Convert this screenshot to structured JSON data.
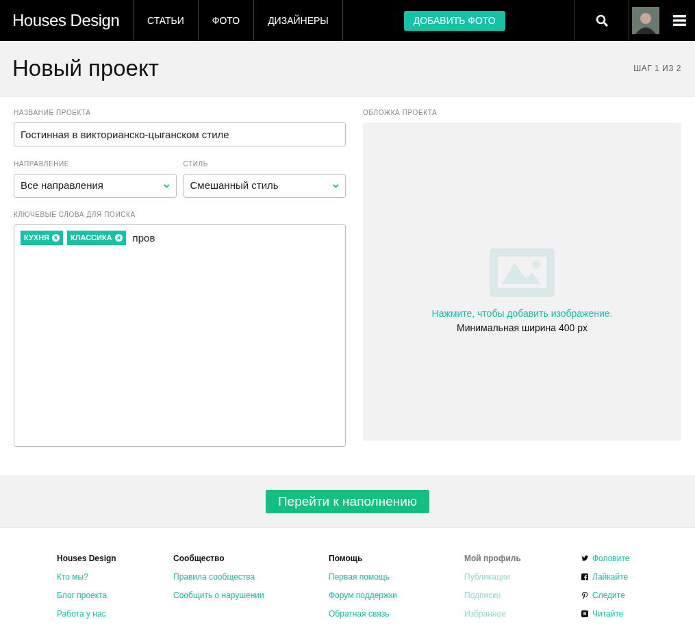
{
  "header": {
    "logo": "Houses **Design**",
    "nav": [
      {
        "label": "СТАТЬИ"
      },
      {
        "label": "ФОТО"
      },
      {
        "label": "ДИЗАЙНЕРЫ"
      }
    ],
    "add_button": "ДОБАВИТЬ ФОТО"
  },
  "page": {
    "title": "Новый проект",
    "step": "ШАГ 1 ИЗ 2"
  },
  "form": {
    "name_label": "НАЗВАНИЕ ПРОЕКТА",
    "name_value": "Гостинная в викторианско-цыганском стиле",
    "selects": [
      {
        "label": "НАПРАВЛЕНИЕ",
        "value": "Все направления"
      },
      {
        "label": "СТИЛЬ",
        "value": "Смешанный стиль"
      }
    ],
    "keywords_label": "КЛЮЧЕВЫЕ СЛОВА ДЛЯ ПОИСКА",
    "tags": [
      "КУХНЯ",
      "КЛАССИКА"
    ],
    "keywords_value": "пров",
    "cover_label": "ОБЛОЖКА ПРОЕКТА",
    "cover_hint": "Нажмите, чтобы добавить изображение.",
    "cover_note": "Минимальная ширина 400 px"
  },
  "submit_button": "Перейти к наполнению",
  "footer": {
    "columns": [
      {
        "heading": "Houses Design",
        "muted": false,
        "links": [
          "Кто мы?",
          "Блог проекта",
          "Работа у нас"
        ]
      },
      {
        "heading": "Сообщество",
        "muted": false,
        "links": [
          "Правила сообщества",
          "Сообщить о нарушении"
        ]
      },
      {
        "heading": "Помощь",
        "muted": false,
        "links": [
          "Первая помощь",
          "Форум поддержки",
          "Обратная связь"
        ]
      },
      {
        "heading": "Мой профиль",
        "muted": true,
        "links": [
          "Публикации",
          "Подписки",
          "Избранное"
        ]
      },
      {
        "kind": "social",
        "muted": false,
        "links": [
          "Фоловите",
          "Лайкайте",
          "Следите",
          "Читайте"
        ]
      }
    ]
  }
}
